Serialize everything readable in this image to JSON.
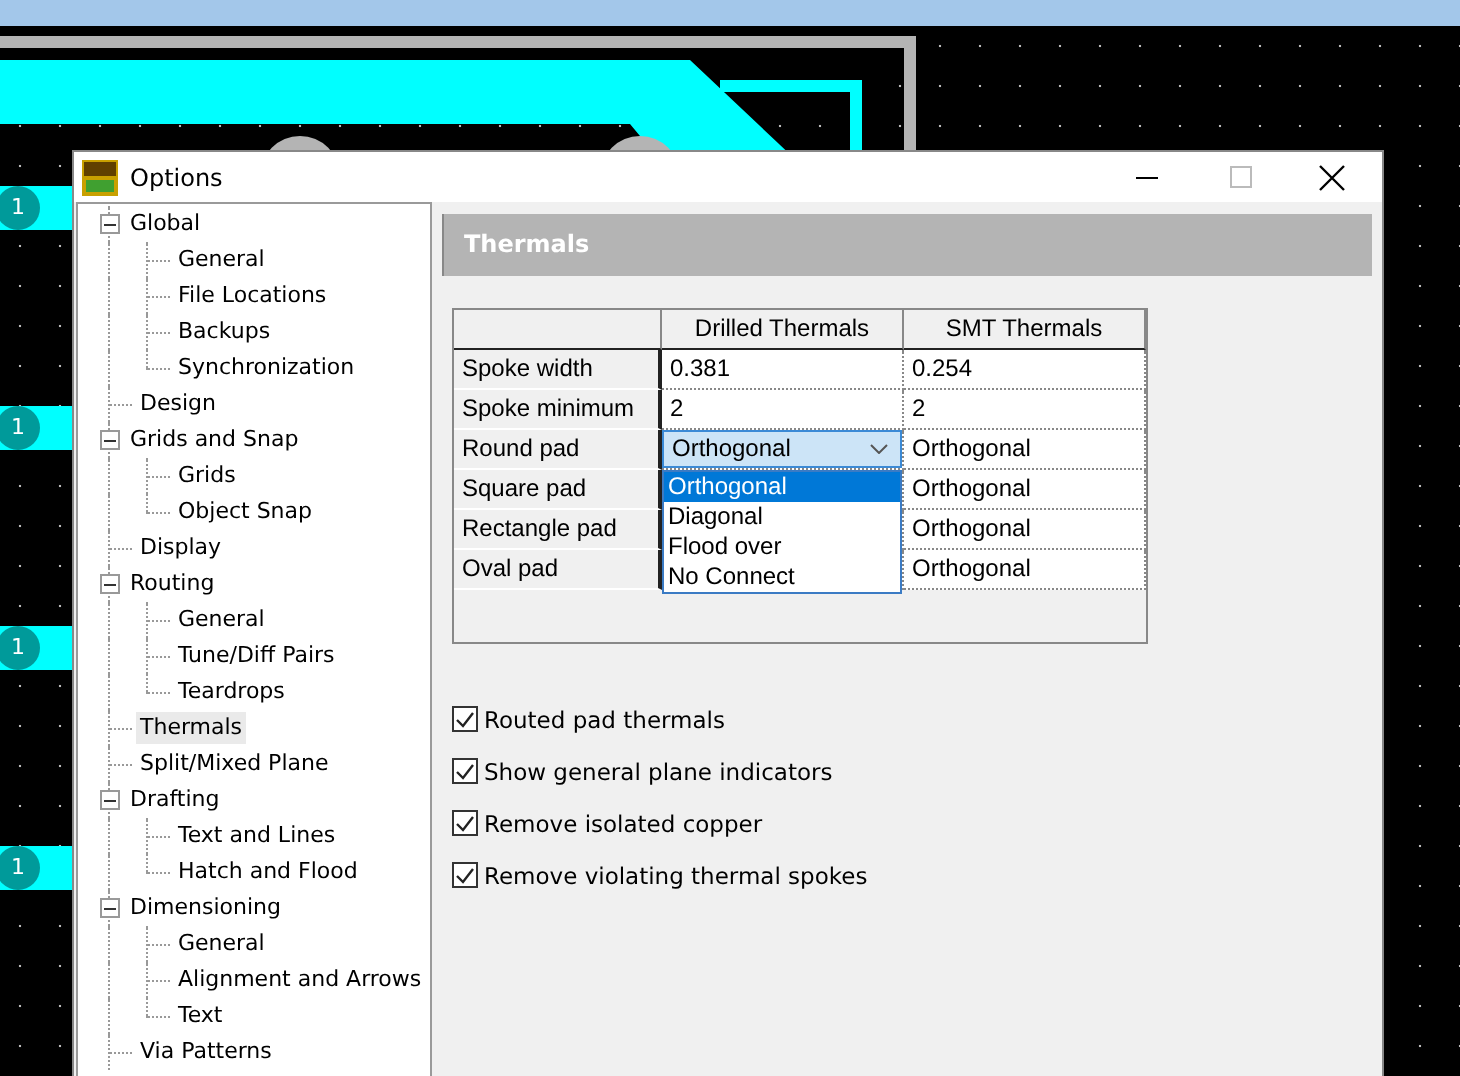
{
  "pads": [
    {
      "label": "1"
    },
    {
      "label": "1"
    },
    {
      "label": "1"
    },
    {
      "label": "1"
    }
  ],
  "window": {
    "title": "Options"
  },
  "tree": [
    {
      "label": "Global",
      "expanded": true,
      "selected": false,
      "children": [
        {
          "label": "General",
          "selected": false
        },
        {
          "label": "File Locations",
          "selected": false
        },
        {
          "label": "Backups",
          "selected": false
        },
        {
          "label": "Synchronization",
          "selected": false
        }
      ]
    },
    {
      "label": "Design",
      "selected": false
    },
    {
      "label": "Grids and Snap",
      "expanded": true,
      "selected": false,
      "children": [
        {
          "label": "Grids",
          "selected": false
        },
        {
          "label": "Object Snap",
          "selected": false
        }
      ]
    },
    {
      "label": "Display",
      "selected": false
    },
    {
      "label": "Routing",
      "expanded": true,
      "selected": false,
      "children": [
        {
          "label": "General",
          "selected": false
        },
        {
          "label": "Tune/Diff Pairs",
          "selected": false
        },
        {
          "label": "Teardrops",
          "selected": false
        }
      ]
    },
    {
      "label": "Thermals",
      "selected": true
    },
    {
      "label": "Split/Mixed Plane",
      "selected": false
    },
    {
      "label": "Drafting",
      "expanded": true,
      "selected": false,
      "children": [
        {
          "label": "Text and Lines",
          "selected": false
        },
        {
          "label": "Hatch and Flood",
          "selected": false
        }
      ]
    },
    {
      "label": "Dimensioning",
      "expanded": true,
      "selected": false,
      "children": [
        {
          "label": "General",
          "selected": false
        },
        {
          "label": "Alignment and Arrows",
          "selected": false
        },
        {
          "label": "Text",
          "selected": false
        }
      ]
    },
    {
      "label": "Via Patterns",
      "selected": false
    }
  ],
  "panel": {
    "title": "Thermals"
  },
  "table": {
    "columns": [
      "Drilled Thermals",
      "SMT Thermals"
    ],
    "rows": [
      {
        "label": "Spoke width",
        "cells": [
          {
            "kind": "text",
            "value": "0.381"
          },
          {
            "kind": "text",
            "value": "0.254"
          }
        ]
      },
      {
        "label": "Spoke minimum",
        "cells": [
          {
            "kind": "text",
            "value": "2"
          },
          {
            "kind": "text",
            "value": "2"
          }
        ]
      },
      {
        "label": "Round pad",
        "cells": [
          {
            "kind": "combo",
            "value": "Orthogonal",
            "expanded": true
          },
          {
            "kind": "text",
            "value": "Orthogonal"
          }
        ]
      },
      {
        "label": "Square pad",
        "cells": [
          {
            "kind": "empty"
          },
          {
            "kind": "text",
            "value": "Orthogonal"
          }
        ]
      },
      {
        "label": "Rectangle pad",
        "cells": [
          {
            "kind": "empty"
          },
          {
            "kind": "text",
            "value": "Orthogonal"
          }
        ]
      },
      {
        "label": "Oval pad",
        "cells": [
          {
            "kind": "empty"
          },
          {
            "kind": "text",
            "value": "Orthogonal"
          }
        ]
      }
    ]
  },
  "dropdown_list": {
    "options": [
      {
        "label": "Orthogonal",
        "selected": true
      },
      {
        "label": "Diagonal",
        "selected": false
      },
      {
        "label": "Flood over",
        "selected": false
      },
      {
        "label": "No Connect",
        "selected": false
      }
    ]
  },
  "checkboxes": [
    {
      "label": "Routed pad thermals",
      "checked": true
    },
    {
      "label": "Show general plane indicators",
      "checked": true
    },
    {
      "label": "Remove isolated copper",
      "checked": true
    },
    {
      "label": "Remove violating thermal spokes",
      "checked": true
    }
  ]
}
